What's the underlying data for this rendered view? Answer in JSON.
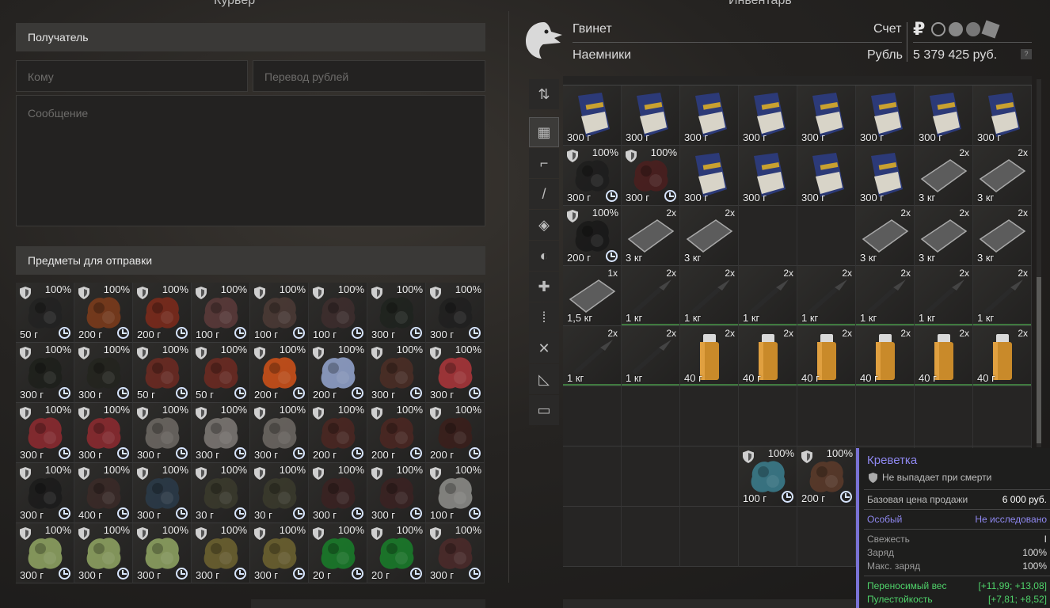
{
  "header": {
    "left_title": "Курьер",
    "right_title": "Инвентарь"
  },
  "transfer": {
    "recipient_label": "Получатель",
    "to_placeholder": "Кому",
    "amount_placeholder": "Перевод рублей",
    "message_placeholder": "Сообщение",
    "items_label": "Предметы для отправки"
  },
  "account": {
    "name": "Гвинет",
    "faction": "Наемники",
    "account_label": "Счет",
    "currency_label": "Рубль",
    "balance": "5 379 425 руб.",
    "help": "?",
    "ruble_symbol": "₽"
  },
  "send_items": [
    {
      "pct": "100%",
      "weight": "50 г",
      "color": "#222"
    },
    {
      "pct": "100%",
      "weight": "200 г",
      "color": "#7a3b1c"
    },
    {
      "pct": "100%",
      "weight": "200 г",
      "color": "#7a2a1c"
    },
    {
      "pct": "100%",
      "weight": "100 г",
      "color": "#5a3a3a"
    },
    {
      "pct": "100%",
      "weight": "100 г",
      "color": "#4a3a35"
    },
    {
      "pct": "100%",
      "weight": "100 г",
      "color": "#3d2d2d"
    },
    {
      "pct": "100%",
      "weight": "300 г",
      "color": "#1f231f"
    },
    {
      "pct": "100%",
      "weight": "300 г",
      "color": "#202020"
    },
    {
      "pct": "100%",
      "weight": "300 г",
      "color": "#1e201c"
    },
    {
      "pct": "100%",
      "weight": "300 г",
      "color": "#23251f"
    },
    {
      "pct": "100%",
      "weight": "50 г",
      "color": "#6a2a22"
    },
    {
      "pct": "100%",
      "weight": "50 г",
      "color": "#6a2a22"
    },
    {
      "pct": "100%",
      "weight": "200 г",
      "color": "#c9501a"
    },
    {
      "pct": "100%",
      "weight": "200 г",
      "color": "#8fa0c8"
    },
    {
      "pct": "100%",
      "weight": "300 г",
      "color": "#4a2e26"
    },
    {
      "pct": "100%",
      "weight": "300 г",
      "color": "#a6353a"
    },
    {
      "pct": "100%",
      "weight": "300 г",
      "color": "#8a2a30"
    },
    {
      "pct": "100%",
      "weight": "300 г",
      "color": "#8a2a30"
    },
    {
      "pct": "100%",
      "weight": "300 г",
      "color": "#6a6662"
    },
    {
      "pct": "100%",
      "weight": "300 г",
      "color": "#7a7672"
    },
    {
      "pct": "100%",
      "weight": "300 г",
      "color": "#6a6662"
    },
    {
      "pct": "100%",
      "weight": "200 г",
      "color": "#4a2722"
    },
    {
      "pct": "100%",
      "weight": "200 г",
      "color": "#4a2722"
    },
    {
      "pct": "100%",
      "weight": "200 г",
      "color": "#3a1f1c"
    },
    {
      "pct": "100%",
      "weight": "300 г",
      "color": "#1c1c1c"
    },
    {
      "pct": "100%",
      "weight": "400 г",
      "color": "#3a2a28"
    },
    {
      "pct": "100%",
      "weight": "300 г",
      "color": "#2a3a48"
    },
    {
      "pct": "100%",
      "weight": "30 г",
      "color": "#3a3a2c"
    },
    {
      "pct": "100%",
      "weight": "30 г",
      "color": "#3a3a2c"
    },
    {
      "pct": "100%",
      "weight": "300 г",
      "color": "#3a2222"
    },
    {
      "pct": "100%",
      "weight": "300 г",
      "color": "#3a2222"
    },
    {
      "pct": "100%",
      "weight": "100 г",
      "color": "#8a8a86"
    },
    {
      "pct": "100%",
      "weight": "300 г",
      "color": "#8ca060"
    },
    {
      "pct": "100%",
      "weight": "300 г",
      "color": "#8ca060"
    },
    {
      "pct": "100%",
      "weight": "300 г",
      "color": "#8ca060"
    },
    {
      "pct": "100%",
      "weight": "300 г",
      "color": "#6a6030"
    },
    {
      "pct": "100%",
      "weight": "300 г",
      "color": "#6a6030"
    },
    {
      "pct": "100%",
      "weight": "20 г",
      "color": "#1a7a2a"
    },
    {
      "pct": "100%",
      "weight": "20 г",
      "color": "#1a7a2a"
    },
    {
      "pct": "100%",
      "weight": "300 г",
      "color": "#4a2a2a"
    }
  ],
  "inventory": [
    {
      "type": "book",
      "weight": "300 г"
    },
    {
      "type": "book",
      "weight": "300 г"
    },
    {
      "type": "book",
      "weight": "300 г"
    },
    {
      "type": "book",
      "weight": "300 г"
    },
    {
      "type": "book",
      "weight": "300 г"
    },
    {
      "type": "book",
      "weight": "300 г"
    },
    {
      "type": "book",
      "weight": "300 г"
    },
    {
      "type": "book",
      "weight": "300 г"
    },
    {
      "type": "art",
      "pct": "100%",
      "weight": "300 г",
      "color": "#1e1e1e",
      "clock": true
    },
    {
      "type": "art",
      "pct": "100%",
      "weight": "300 г",
      "color": "#4a1f1f",
      "clock": true
    },
    {
      "type": "book",
      "weight": "300 г"
    },
    {
      "type": "book",
      "weight": "300 г"
    },
    {
      "type": "book",
      "weight": "300 г"
    },
    {
      "type": "book",
      "weight": "300 г"
    },
    {
      "type": "plate",
      "count": "2x",
      "weight": "3 кг"
    },
    {
      "type": "plate",
      "count": "2x",
      "weight": "3 кг"
    },
    {
      "type": "art",
      "pct": "100%",
      "weight": "200 г",
      "color": "#1a1a1a",
      "clock": true
    },
    {
      "type": "plate",
      "count": "2x",
      "weight": "3 кг"
    },
    {
      "type": "plate",
      "count": "2x",
      "weight": "3 кг"
    },
    {
      "type": "empty"
    },
    {
      "type": "empty"
    },
    {
      "type": "plate",
      "count": "2x",
      "weight": "3 кг"
    },
    {
      "type": "plate",
      "count": "2x",
      "weight": "3 кг"
    },
    {
      "type": "plate",
      "count": "2x",
      "weight": "3 кг"
    },
    {
      "type": "plate",
      "count": "1x",
      "weight": "1,5 кг"
    },
    {
      "type": "knife",
      "count": "2x",
      "weight": "1 кг"
    },
    {
      "type": "knife",
      "count": "2x",
      "weight": "1 кг"
    },
    {
      "type": "knife",
      "count": "2x",
      "weight": "1 кг"
    },
    {
      "type": "knife",
      "count": "2x",
      "weight": "1 кг"
    },
    {
      "type": "knife",
      "count": "2x",
      "weight": "1 кг"
    },
    {
      "type": "knife",
      "count": "2x",
      "weight": "1 кг"
    },
    {
      "type": "knife",
      "count": "2x",
      "weight": "1 кг"
    },
    {
      "type": "knife",
      "count": "2x",
      "weight": "1 кг"
    },
    {
      "type": "knife",
      "count": "2x",
      "weight": "1 кг"
    },
    {
      "type": "lighter",
      "count": "2x",
      "weight": "40 г"
    },
    {
      "type": "lighter",
      "count": "2x",
      "weight": "40 г"
    },
    {
      "type": "lighter",
      "count": "2x",
      "weight": "40 г"
    },
    {
      "type": "lighter",
      "count": "2x",
      "weight": "40 г"
    },
    {
      "type": "lighter",
      "count": "2x",
      "weight": "40 г"
    },
    {
      "type": "lighter",
      "count": "2x",
      "weight": "40 г"
    },
    {
      "type": "empty"
    },
    {
      "type": "empty"
    },
    {
      "type": "empty"
    },
    {
      "type": "empty"
    },
    {
      "type": "empty"
    },
    {
      "type": "empty"
    },
    {
      "type": "empty"
    },
    {
      "type": "empty"
    },
    {
      "type": "empty"
    },
    {
      "type": "empty"
    },
    {
      "type": "empty"
    },
    {
      "type": "art",
      "pct": "100%",
      "weight": "100 г",
      "color": "#3a7a8a",
      "clock": true
    },
    {
      "type": "art",
      "pct": "100%",
      "weight": "200 г",
      "color": "#5a3a2a",
      "clock": true
    },
    {
      "type": "empty"
    },
    {
      "type": "empty"
    },
    {
      "type": "empty"
    },
    {
      "type": "empty"
    },
    {
      "type": "empty"
    },
    {
      "type": "empty"
    },
    {
      "type": "empty"
    },
    {
      "type": "empty"
    },
    {
      "type": "empty"
    },
    {
      "type": "empty"
    },
    {
      "type": "empty"
    }
  ],
  "side_tabs": [
    "sort",
    "grid",
    "rifle",
    "knife",
    "armor",
    "helmet",
    "medkit",
    "ammo",
    "tools",
    "misc",
    "archive"
  ],
  "tooltip": {
    "title": "Креветка",
    "no_drop": "Не выпадает при смерти",
    "price_label": "Базовая цена продажи",
    "price": "6 000 руб.",
    "rarity": "Особый",
    "research": "Не исследовано",
    "fresh_label": "Свежесть",
    "fresh_value": "I",
    "charge_label": "Заряд",
    "charge_value": "100%",
    "maxcharge_label": "Макс. заряд",
    "maxcharge_value": "100%",
    "stat1_label": "Переносимый вес",
    "stat1_value": "[+11,99; +13,08]",
    "stat2_label": "Пулестойкость",
    "stat2_value": "[+7,81; +8,52]"
  }
}
